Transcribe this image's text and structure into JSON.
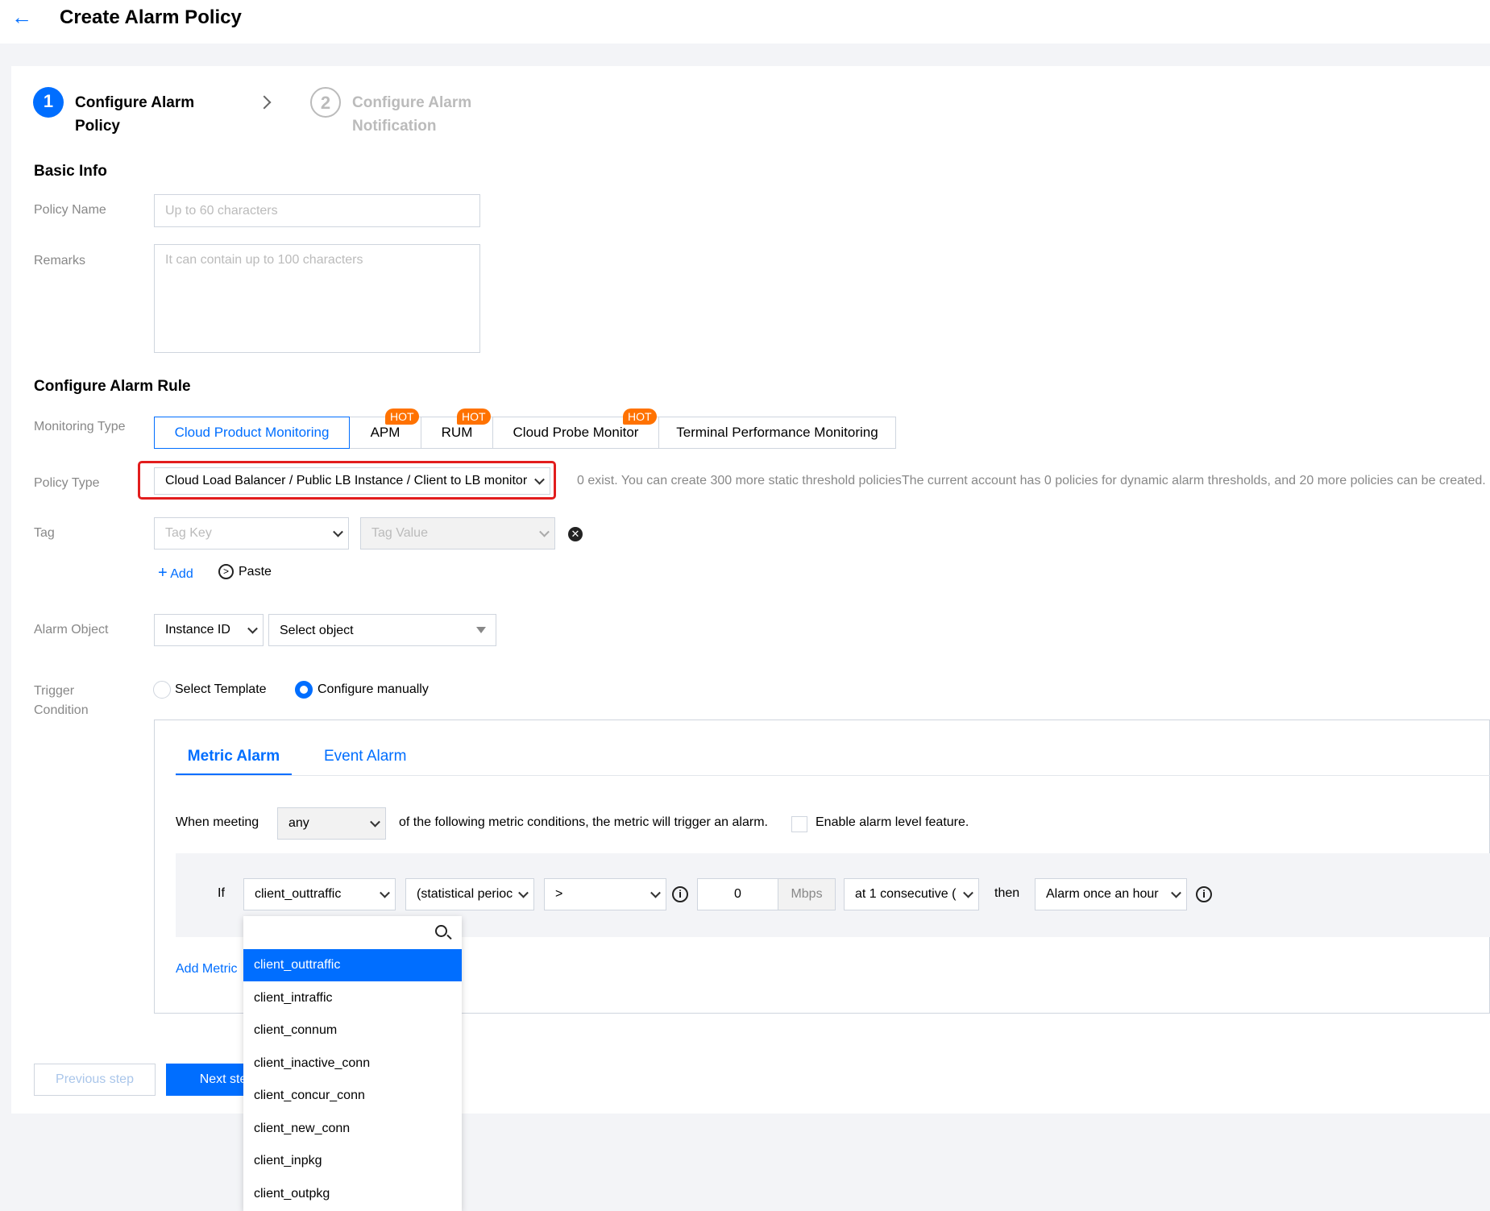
{
  "header": {
    "back_icon": "arrow-left-icon",
    "title": "Create Alarm Policy"
  },
  "steps": [
    {
      "number": "1",
      "line1": "Configure Alarm",
      "line2": "Policy"
    },
    {
      "number": "2",
      "line1": "Configure Alarm",
      "line2": "Notification"
    }
  ],
  "basic_info": {
    "title": "Basic Info",
    "policy_name_label": "Policy Name",
    "policy_name_placeholder": "Up to 60 characters",
    "remarks_label": "Remarks",
    "remarks_placeholder": "It can contain up to 100 characters"
  },
  "rule": {
    "title": "Configure Alarm Rule",
    "monitoring_type_label": "Monitoring Type",
    "monitoring_tabs": [
      {
        "label": "Cloud Product Monitoring",
        "hot": ""
      },
      {
        "label": "APM",
        "hot": "HOT"
      },
      {
        "label": "RUM",
        "hot": "HOT"
      },
      {
        "label": "Cloud Probe Monitor",
        "hot": "HOT"
      },
      {
        "label": "Terminal Performance Monitoring",
        "hot": ""
      }
    ],
    "policy_type_label": "Policy Type",
    "policy_type_value": "Cloud Load Balancer / Public LB Instance / Client to LB monitor",
    "policy_quota_text": "0 exist. You can create 300 more static threshold policiesThe current account has 0 policies for dynamic alarm thresholds, and 20 more policies can be created.",
    "tag_label": "Tag",
    "tag_key_placeholder": "Tag Key",
    "tag_value_placeholder": "Tag Value",
    "add_label": "Add",
    "paste_label": "Paste",
    "alarm_object_label": "Alarm Object",
    "alarm_object_type": "Instance ID",
    "alarm_object_placeholder": "Select object",
    "trigger_label_1": "Trigger",
    "trigger_label_2": "Condition",
    "radio_template": "Select Template",
    "radio_manual": "Configure manually"
  },
  "trigger": {
    "tab_metric": "Metric Alarm",
    "tab_event": "Event Alarm",
    "when_meeting": "When meeting",
    "any_value": "any",
    "condition_text": "of the following metric conditions, the metric will trigger an alarm.",
    "enable_level": "Enable alarm level feature.",
    "if_label": "If",
    "metric_value": "client_outtraffic",
    "period_value": "(statistical perioc",
    "operator_value": ">",
    "threshold_value": "0",
    "unit": "Mbps",
    "consecutive_value": "at 1 consecutive (",
    "then_label": "then",
    "frequency_value": "Alarm once an hour",
    "add_metric": "Add Metric"
  },
  "metric_dropdown": {
    "options": [
      "client_outtraffic",
      "client_intraffic",
      "client_connum",
      "client_inactive_conn",
      "client_concur_conn",
      "client_new_conn",
      "client_inpkg",
      "client_outpkg"
    ],
    "selected_index": 0
  },
  "footer": {
    "previous_step": "Previous step",
    "next_step": "Next step"
  },
  "colors": {
    "primary": "#006eff",
    "hot": "#ff7200",
    "highlight_border": "#e21d1d"
  }
}
